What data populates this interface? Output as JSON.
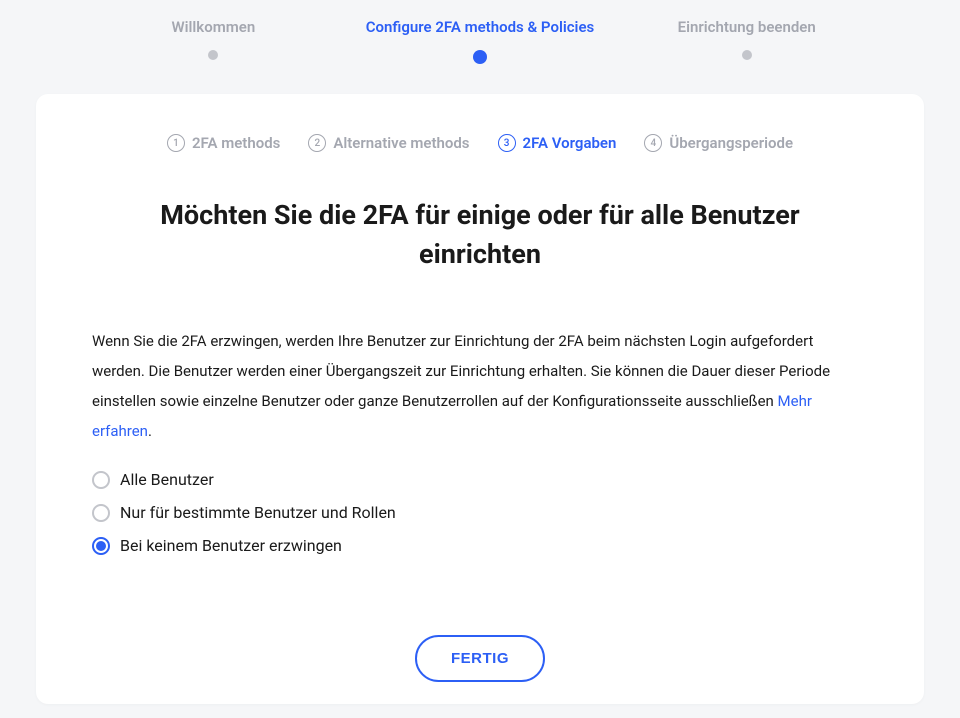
{
  "topStepper": {
    "steps": [
      {
        "label": "Willkommen",
        "active": false
      },
      {
        "label": "Configure 2FA methods & Policies",
        "active": true
      },
      {
        "label": "Einrichtung beenden",
        "active": false
      }
    ]
  },
  "subStepper": {
    "steps": [
      {
        "num": "1",
        "label": "2FA methods",
        "active": false
      },
      {
        "num": "2",
        "label": "Alternative methods",
        "active": false
      },
      {
        "num": "3",
        "label": "2FA Vorgaben",
        "active": true
      },
      {
        "num": "4",
        "label": "Übergangsperiode",
        "active": false
      }
    ]
  },
  "heading": "Möchten Sie die 2FA für einige oder für alle Benutzer einrichten",
  "description": {
    "text": "Wenn Sie die 2FA erzwingen, werden Ihre Benutzer zur Einrichtung der 2FA beim nächsten Login aufgefordert werden. Die Benutzer werden einer Übergangszeit zur Einrichtung erhalten. Sie können die Dauer dieser Periode einstellen sowie einzelne Benutzer oder ganze Benutzerrollen auf der Konfigurationsseite ausschließen ",
    "linkText": "Mehr erfahren",
    "suffix": "."
  },
  "radios": [
    {
      "label": "Alle Benutzer",
      "checked": false
    },
    {
      "label": "Nur für bestimmte Benutzer und Rollen",
      "checked": false
    },
    {
      "label": "Bei keinem Benutzer erzwingen",
      "checked": true
    }
  ],
  "doneButton": "FERTIG"
}
